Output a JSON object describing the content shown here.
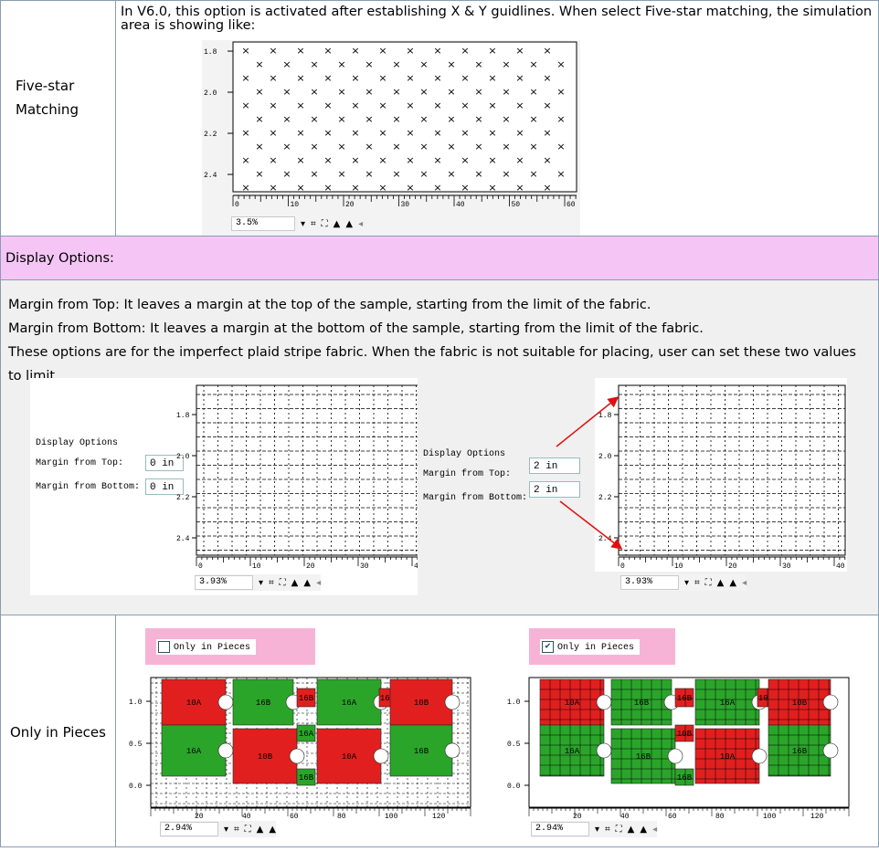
{
  "five_star": {
    "label_line1": "Five-star",
    "label_line2": "Matching",
    "description": "In V6.0, this option is activated after establishing X & Y guidlines.  When select Five-star matching, the simulation area is showing like:",
    "y_ticks": [
      "1.8",
      "2.0",
      "2.2",
      "2.4"
    ],
    "x_ticks": [
      "0",
      "10",
      "20",
      "30",
      "40",
      "50",
      "60"
    ],
    "zoom": "3.5%",
    "mark_glyph": "×"
  },
  "display_options": {
    "header": "Display Options:",
    "para_top": "Margin from Top: It leaves a margin at the top of the sample, starting from the limit of the fabric.",
    "para_bottom": "Margin from Bottom: It leaves a margin at the bottom of the sample, starting from the limit of the fabric.",
    "para_purpose": "These options are for the imperfect plaid stripe fabric. When the fabric is not suitable for placing, user can set these two values to limit.",
    "options_title": "Display Options",
    "margin_top_label": "Margin from Top:",
    "margin_bottom_label": "Margin from Bottom:",
    "left_example": {
      "margin_top": "0 in",
      "margin_bottom": "0 in",
      "zoom": "3.93%"
    },
    "right_example": {
      "margin_top": "2 in",
      "margin_bottom": "2 in",
      "zoom": "3.93%"
    },
    "y_ticks": [
      "1.8",
      "2.0",
      "2.2",
      "2.4"
    ],
    "x_ticks": [
      "0",
      "10",
      "20",
      "30",
      "40"
    ],
    "arrow_color": "#e01010"
  },
  "only_in_pieces": {
    "label": "Only in Pieces",
    "checkbox_label": "Only in Pieces",
    "unchecked_mark": "",
    "checked_mark": "✔",
    "zoom": "2.94%",
    "y_ticks": [
      "1.0",
      "0.5",
      "0.0"
    ],
    "x_ticks": [
      "20",
      "40",
      "60",
      "80",
      "100",
      "120"
    ],
    "piece_colors": {
      "red": "#e21f1f",
      "green": "#2aa52a"
    },
    "pieces_left": [
      {
        "name": "10A",
        "color": "red"
      },
      {
        "name": "16B",
        "color": "green"
      },
      {
        "name": "16B",
        "color": "red"
      },
      {
        "name": "16A",
        "color": "green"
      },
      {
        "name": "16A",
        "color": "red"
      },
      {
        "name": "10B",
        "color": "red"
      },
      {
        "name": "16A",
        "color": "green"
      },
      {
        "name": "10B",
        "color": "red"
      },
      {
        "name": "16A",
        "color": "green"
      },
      {
        "name": "10A",
        "color": "red"
      },
      {
        "name": "16B",
        "color": "green"
      },
      {
        "name": "16B",
        "color": "green"
      }
    ],
    "pieces_right": [
      {
        "name": "10A",
        "color": "red"
      },
      {
        "name": "16B",
        "color": "green"
      },
      {
        "name": "16B",
        "color": "red"
      },
      {
        "name": "16A",
        "color": "green"
      },
      {
        "name": "10A",
        "color": "red"
      },
      {
        "name": "10B",
        "color": "red"
      },
      {
        "name": "16A",
        "color": "green"
      },
      {
        "name": "16B",
        "color": "green"
      },
      {
        "name": "10B",
        "color": "red"
      },
      {
        "name": "10A",
        "color": "red"
      },
      {
        "name": "16B",
        "color": "green"
      },
      {
        "name": "16B",
        "color": "green"
      }
    ]
  },
  "colors": {
    "display_header_bg": "#f5c6f5",
    "checkbox_bg": "#f7b3d6",
    "grey_bg": "#f0f0f0",
    "grid_border": "#8a9bb4"
  }
}
